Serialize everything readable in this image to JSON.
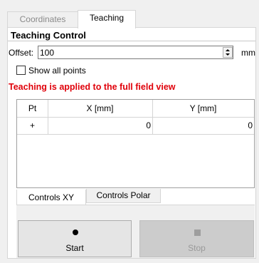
{
  "tabs": [
    {
      "label": "Coordinates",
      "active": false
    },
    {
      "label": "Teaching",
      "active": true
    }
  ],
  "teaching": {
    "title": "Teaching Control",
    "offset": {
      "label": "Offset:",
      "value": "100",
      "unit": "mm"
    },
    "show_all_points": {
      "label": "Show all points",
      "checked": false
    },
    "warning": "Teaching is applied to the full field view",
    "warning_color": "#e0000a",
    "table": {
      "headers": [
        "Pt",
        "X [mm]",
        "Y [mm]"
      ],
      "rows": [
        {
          "pt": "+",
          "x": "0",
          "y": "0"
        }
      ]
    },
    "subtabs": [
      {
        "label": "Controls XY",
        "active": true
      },
      {
        "label": "Controls Polar",
        "active": false
      }
    ],
    "buttons": {
      "start": {
        "label": "Start",
        "icon": "record-icon",
        "enabled": true
      },
      "stop": {
        "label": "Stop",
        "icon": "stop-icon",
        "enabled": false
      }
    }
  }
}
